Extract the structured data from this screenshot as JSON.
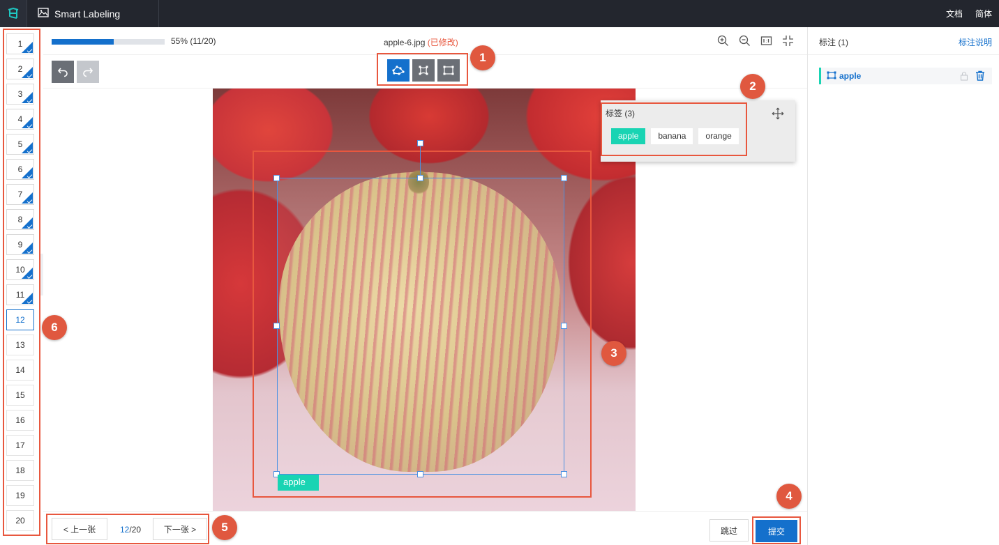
{
  "app": {
    "title": "Smart Labeling",
    "top_links": [
      "文档",
      "简体"
    ]
  },
  "progress": {
    "percent": 55,
    "text": "55% (11/20)"
  },
  "file": {
    "name": "apple-6.jpg",
    "status": "(已修改)"
  },
  "thumbnails": [
    "1",
    "2",
    "3",
    "4",
    "5",
    "6",
    "7",
    "8",
    "9",
    "10",
    "11",
    "12",
    "13",
    "14",
    "15",
    "16",
    "17",
    "18",
    "19",
    "20"
  ],
  "thumbnails_done_count": 11,
  "current_index": 12,
  "collapse_glyph": ">",
  "label_popup": {
    "title": "标签 (3)",
    "tags": [
      "apple",
      "banana",
      "orange"
    ],
    "selected": "apple"
  },
  "box_label": "apple",
  "annotations_panel": {
    "title": "标注 (1)",
    "help_link": "标注说明",
    "items": [
      {
        "name": "apple"
      }
    ]
  },
  "pagination": {
    "prev": "< 上一张",
    "current": "12",
    "total_suffix": "/20",
    "next": "下一张 >"
  },
  "actions": {
    "skip": "跳过",
    "submit": "提交"
  },
  "callouts": [
    "1",
    "2",
    "3",
    "4",
    "5",
    "6"
  ],
  "colors": {
    "accent": "#1470cc",
    "tag_green": "#19d4b3",
    "callout": "#e0583f",
    "topbar": "#23262e"
  }
}
